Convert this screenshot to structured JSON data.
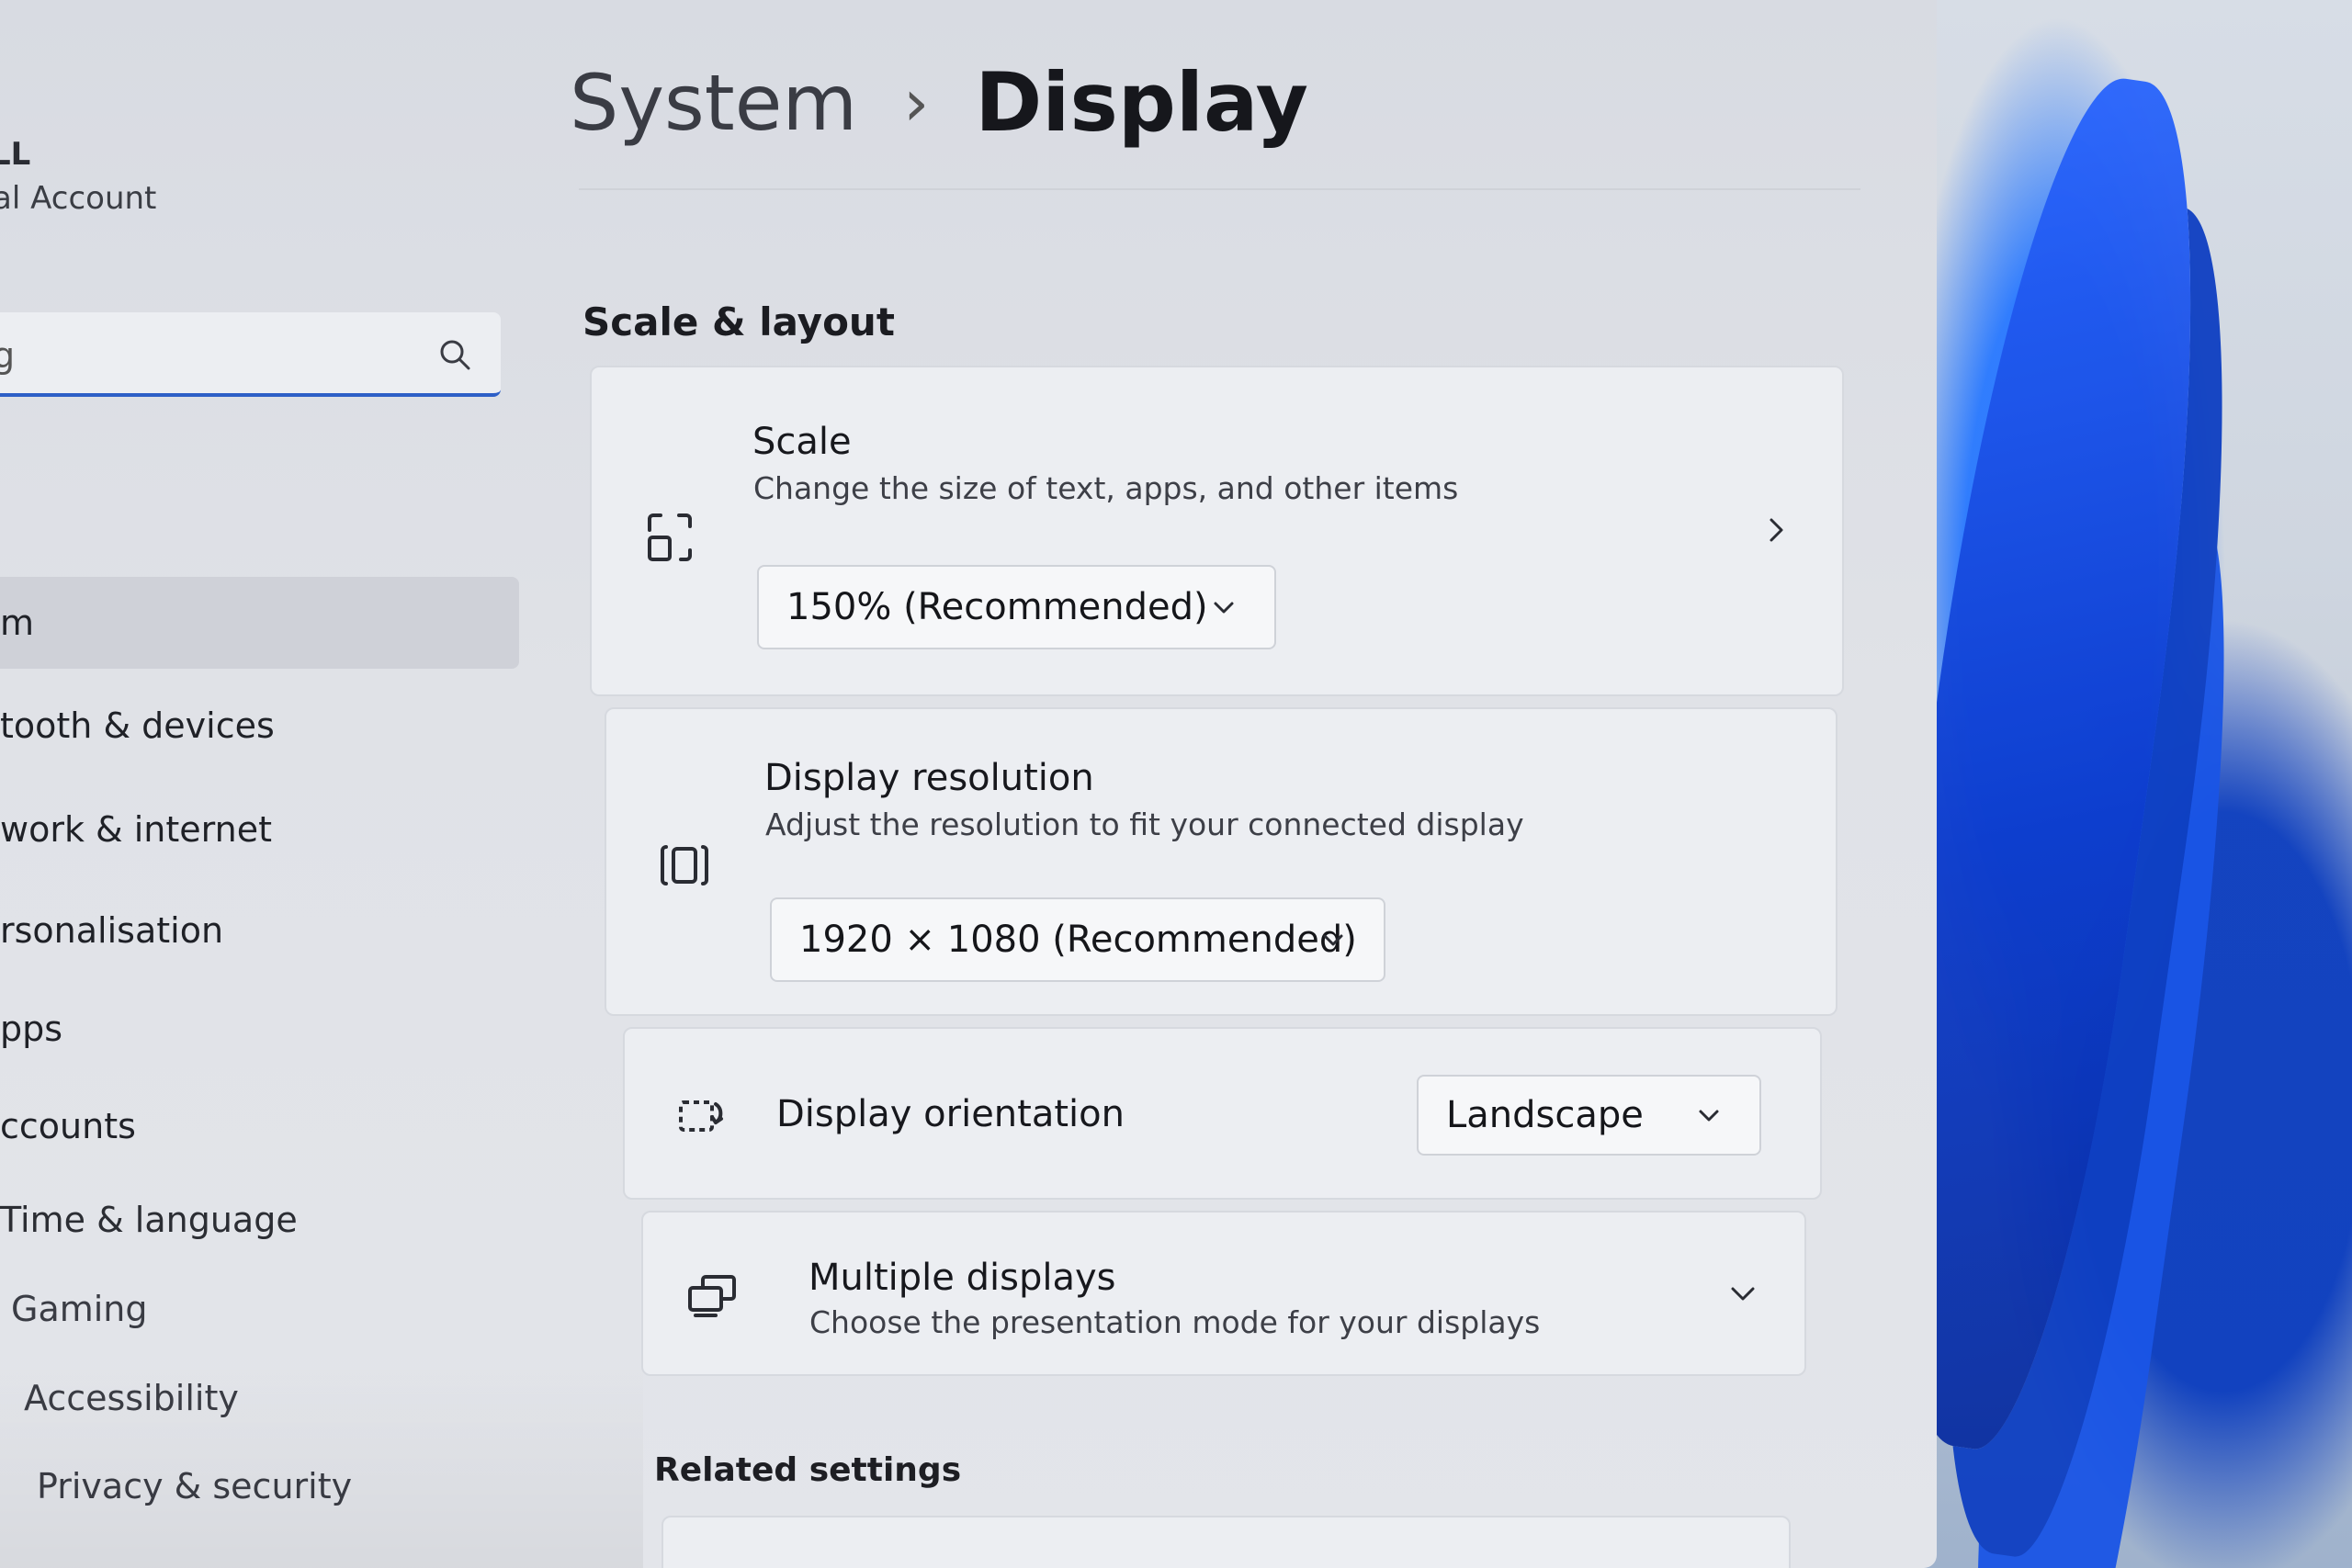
{
  "user": {
    "name": "LL",
    "account_type": "al Account"
  },
  "search": {
    "value": "g"
  },
  "sidebar": {
    "items": [
      {
        "label": "",
        "selected": false
      },
      {
        "label": "m",
        "selected": true
      },
      {
        "label": "tooth & devices",
        "selected": false
      },
      {
        "label": "work & internet",
        "selected": false
      },
      {
        "label": "rsonalisation",
        "selected": false
      },
      {
        "label": "pps",
        "selected": false
      },
      {
        "label": "ccounts",
        "selected": false
      },
      {
        "label": "Time & language",
        "selected": false
      },
      {
        "label": "Gaming",
        "selected": false
      },
      {
        "label": "Accessibility",
        "selected": false
      },
      {
        "label": "Privacy & security",
        "selected": false
      }
    ]
  },
  "breadcrumb": {
    "parent": "System",
    "separator": "›",
    "current": "Display"
  },
  "scale_layout": {
    "title": "Scale & layout",
    "scale": {
      "title": "Scale",
      "description": "Change the size of text, apps, and other items",
      "value": "150% (Recommended)"
    },
    "resolution": {
      "title": "Display resolution",
      "description": "Adjust the resolution to fit your connected display",
      "value": "1920 × 1080 (Recommended)"
    },
    "orientation": {
      "title": "Display orientation",
      "value": "Landscape"
    },
    "multiple": {
      "title": "Multiple displays",
      "description": "Choose the presentation mode for your displays"
    }
  },
  "related": {
    "title": "Related settings"
  },
  "colors": {
    "accent": "#2d5fc7",
    "card": "#eceef2",
    "window": "#e0e2e7"
  }
}
